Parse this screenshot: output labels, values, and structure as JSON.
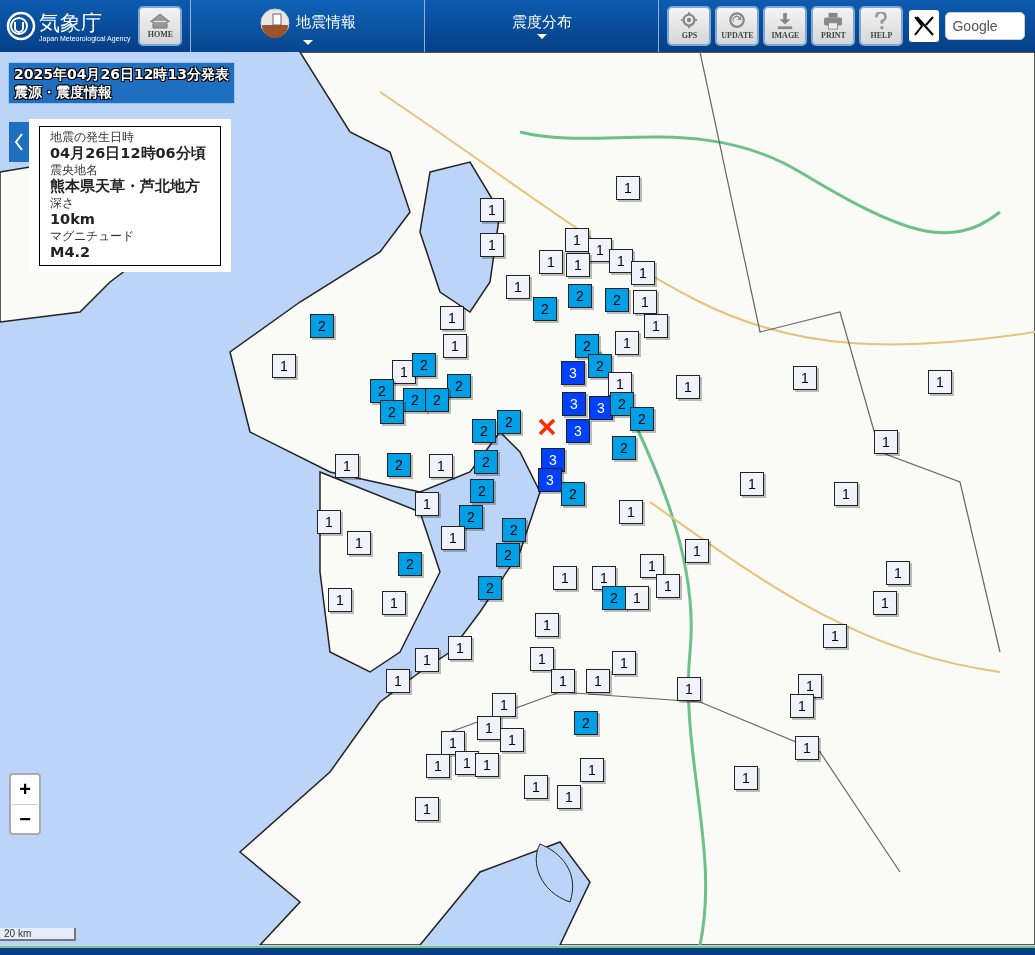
{
  "header": {
    "logo": {
      "title": "気象庁",
      "subtitle": "Japan Meteorological Agency"
    },
    "home_button": "HOME",
    "menus": [
      {
        "label": "地震情報",
        "selected": true
      },
      {
        "label": "震度分布",
        "selected": false
      }
    ],
    "tool_buttons": [
      "GPS",
      "UPDATE",
      "IMAGE",
      "PRINT",
      "HELP"
    ],
    "search": {
      "placeholder": "Google"
    }
  },
  "report": {
    "title": "2025年04月26日12時13分発表",
    "subtitle": "震源・震度情報"
  },
  "details": [
    {
      "label": "地震の発生日時",
      "value": "04月26日12時06分頃"
    },
    {
      "label": "震央地名",
      "value": "熊本県天草・芦北地方"
    },
    {
      "label": "深さ",
      "value": "10km"
    },
    {
      "label": "マグニチュード",
      "value": "M4.2"
    }
  ],
  "zoom": {
    "in": "+",
    "out": "−"
  },
  "scale": "20 km",
  "markers": [
    {
      "intensity": "1",
      "color": "#f2f2fa"
    },
    {
      "intensity": "1",
      "color": "#f2f2fa"
    },
    {
      "intensity": "1",
      "color": "#f2f2fa"
    },
    {
      "intensity": "1",
      "color": "#f2f2fa"
    },
    {
      "intensity": "1",
      "color": "#f2f2fa"
    },
    {
      "intensity": "1",
      "color": "#f2f2fa"
    },
    {
      "intensity": "1",
      "color": "#f2f2fa"
    },
    {
      "intensity": "1",
      "color": "#f2f2fa"
    },
    {
      "intensity": "1",
      "color": "#f2f2fa"
    },
    {
      "intensity": "1",
      "color": "#f2f2fa"
    },
    {
      "intensity": "2",
      "color": "#00a0e6"
    },
    {
      "intensity": "2",
      "color": "#00a0e6"
    },
    {
      "intensity": "1",
      "color": "#f2f2fa"
    },
    {
      "intensity": "2",
      "color": "#00a0e6"
    },
    {
      "intensity": "2",
      "color": "#00a0e6"
    },
    {
      "intensity": "1",
      "color": "#f2f2fa"
    },
    {
      "intensity": "1",
      "color": "#f2f2fa"
    },
    {
      "intensity": "1",
      "color": "#f2f2fa"
    },
    {
      "intensity": "2",
      "color": "#00a0e6"
    },
    {
      "intensity": "1",
      "color": "#f2f2fa"
    },
    {
      "intensity": "1",
      "color": "#f2f2fa"
    },
    {
      "intensity": "1",
      "color": "#f2f2fa"
    },
    {
      "intensity": "2",
      "color": "#00a0e6"
    },
    {
      "intensity": "3",
      "color": "#0041ff"
    },
    {
      "intensity": "2",
      "color": "#00a0e6"
    },
    {
      "intensity": "2",
      "color": "#00a0e6"
    },
    {
      "intensity": "1",
      "color": "#f2f2fa"
    },
    {
      "intensity": "1",
      "color": "#f2f2fa"
    },
    {
      "intensity": "1",
      "color": "#f2f2fa"
    },
    {
      "intensity": "1",
      "color": "#f2f2fa"
    },
    {
      "intensity": "2",
      "color": "#00a0e6"
    },
    {
      "intensity": "2",
      "color": "#00a0e6"
    },
    {
      "intensity": "2",
      "color": "#00a0e6"
    },
    {
      "intensity": "3",
      "color": "#0041ff"
    },
    {
      "intensity": "3",
      "color": "#0041ff"
    },
    {
      "intensity": "2",
      "color": "#00a0e6"
    },
    {
      "intensity": "2",
      "color": "#00a0e6"
    },
    {
      "intensity": "2",
      "color": "#00a0e6"
    },
    {
      "intensity": "2",
      "color": "#00a0e6"
    },
    {
      "intensity": "2",
      "color": "#00a0e6"
    },
    {
      "intensity": "3",
      "color": "#0041ff"
    },
    {
      "intensity": "2",
      "color": "#00a0e6"
    },
    {
      "intensity": "1",
      "color": "#f2f2fa"
    },
    {
      "intensity": "1",
      "color": "#f2f2fa"
    },
    {
      "intensity": "2",
      "color": "#00a0e6"
    },
    {
      "intensity": "1",
      "color": "#f2f2fa"
    },
    {
      "intensity": "2",
      "color": "#00a0e6"
    },
    {
      "intensity": "3",
      "color": "#0041ff"
    },
    {
      "intensity": "3",
      "color": "#0041ff"
    },
    {
      "intensity": "1",
      "color": "#f2f2fa"
    },
    {
      "intensity": "2",
      "color": "#00a0e6"
    },
    {
      "intensity": "2",
      "color": "#00a0e6"
    },
    {
      "intensity": "1",
      "color": "#f2f2fa"
    },
    {
      "intensity": "1",
      "color": "#f2f2fa"
    },
    {
      "intensity": "2",
      "color": "#00a0e6"
    },
    {
      "intensity": "1",
      "color": "#f2f2fa"
    },
    {
      "intensity": "1",
      "color": "#f2f2fa"
    },
    {
      "intensity": "2",
      "color": "#00a0e6"
    },
    {
      "intensity": "1",
      "color": "#f2f2fa"
    },
    {
      "intensity": "1",
      "color": "#f2f2fa"
    },
    {
      "intensity": "2",
      "color": "#00a0e6"
    },
    {
      "intensity": "1",
      "color": "#f2f2fa"
    },
    {
      "intensity": "2",
      "color": "#00a0e6"
    },
    {
      "intensity": "1",
      "color": "#f2f2fa"
    },
    {
      "intensity": "1",
      "color": "#f2f2fa"
    },
    {
      "intensity": "1",
      "color": "#f2f2fa"
    },
    {
      "intensity": "1",
      "color": "#f2f2fa"
    },
    {
      "intensity": "2",
      "color": "#00a0e6"
    },
    {
      "intensity": "1",
      "color": "#f2f2fa"
    },
    {
      "intensity": "1",
      "color": "#f2f2fa"
    },
    {
      "intensity": "1",
      "color": "#f2f2fa"
    },
    {
      "intensity": "2",
      "color": "#00a0e6"
    },
    {
      "intensity": "1",
      "color": "#f2f2fa"
    },
    {
      "intensity": "1",
      "color": "#f2f2fa"
    },
    {
      "intensity": "1",
      "color": "#f2f2fa"
    },
    {
      "intensity": "1",
      "color": "#f2f2fa"
    },
    {
      "intensity": "1",
      "color": "#f2f2fa"
    },
    {
      "intensity": "1",
      "color": "#f2f2fa"
    },
    {
      "intensity": "1",
      "color": "#f2f2fa"
    },
    {
      "intensity": "1",
      "color": "#f2f2fa"
    },
    {
      "intensity": "1",
      "color": "#f2f2fa"
    },
    {
      "intensity": "1",
      "color": "#f2f2fa"
    },
    {
      "intensity": "1",
      "color": "#f2f2fa"
    },
    {
      "intensity": "1",
      "color": "#f2f2fa"
    },
    {
      "intensity": "1",
      "color": "#f2f2fa"
    },
    {
      "intensity": "1",
      "color": "#f2f2fa"
    },
    {
      "intensity": "1",
      "color": "#f2f2fa"
    },
    {
      "intensity": "1",
      "color": "#f2f2fa"
    },
    {
      "intensity": "2",
      "color": "#00a0e6"
    },
    {
      "intensity": "1",
      "color": "#f2f2fa"
    },
    {
      "intensity": "1",
      "color": "#f2f2fa"
    },
    {
      "intensity": "1",
      "color": "#f2f2fa"
    },
    {
      "intensity": "1",
      "color": "#f2f2fa"
    },
    {
      "intensity": "1",
      "color": "#f2f2fa"
    },
    {
      "intensity": "1",
      "color": "#f2f2fa"
    },
    {
      "intensity": "1",
      "color": "#f2f2fa"
    },
    {
      "intensity": "1",
      "color": "#f2f2fa"
    },
    {
      "intensity": "1",
      "color": "#f2f2fa"
    },
    {
      "intensity": "1",
      "color": "#f2f2fa"
    },
    {
      "intensity": "1",
      "color": "#f2f2fa"
    }
  ]
}
